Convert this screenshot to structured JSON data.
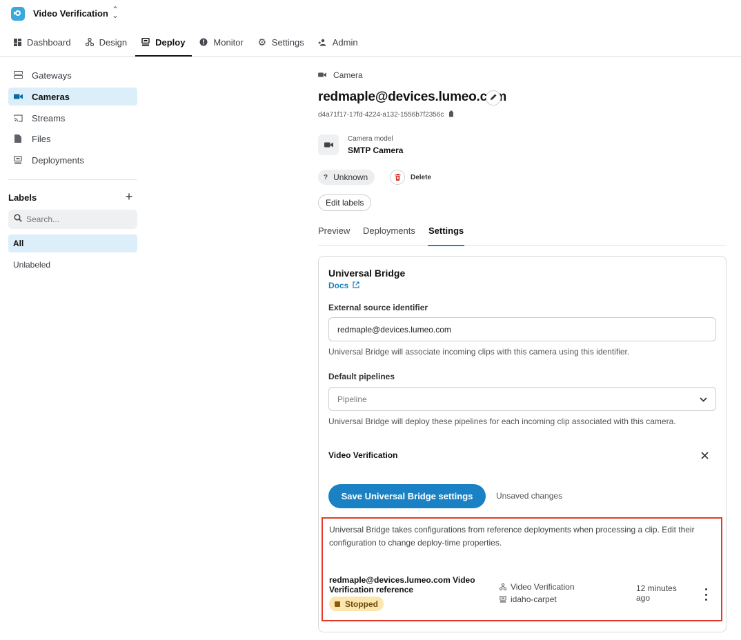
{
  "app": {
    "title": "Video Verification"
  },
  "nav": {
    "tabs": [
      {
        "label": "Dashboard",
        "icon": "dashboard-icon"
      },
      {
        "label": "Design",
        "icon": "design-icon"
      },
      {
        "label": "Deploy",
        "icon": "deploy-icon",
        "active": true
      },
      {
        "label": "Monitor",
        "icon": "monitor-icon"
      },
      {
        "label": "Settings",
        "icon": "gear-icon"
      },
      {
        "label": "Admin",
        "icon": "admin-icon"
      }
    ]
  },
  "sidebar": {
    "items": [
      {
        "label": "Gateways",
        "icon": "gateway-icon"
      },
      {
        "label": "Cameras",
        "icon": "camera-icon",
        "active": true
      },
      {
        "label": "Streams",
        "icon": "stream-icon"
      },
      {
        "label": "Files",
        "icon": "file-icon"
      },
      {
        "label": "Deployments",
        "icon": "deployment-icon"
      }
    ],
    "labels_title": "Labels",
    "search_placeholder": "Search...",
    "filters": [
      {
        "label": "All",
        "active": true
      },
      {
        "label": "Unlabeled"
      }
    ]
  },
  "camera": {
    "breadcrumb": "Camera",
    "name": "redmaple@devices.lumeo.com",
    "uuid": "d4a71f17-17fd-4224-a132-1556b7f2356c",
    "model_label": "Camera model",
    "model_value": "SMTP Camera",
    "status": "Unknown",
    "delete_label": "Delete",
    "edit_labels": "Edit labels"
  },
  "tabs": [
    {
      "label": "Preview"
    },
    {
      "label": "Deployments"
    },
    {
      "label": "Settings",
      "active": true
    }
  ],
  "bridge": {
    "title": "Universal Bridge",
    "docs": "Docs",
    "ext_source_label": "External source identifier",
    "ext_source_value": "redmaple@devices.lumeo.com",
    "ext_source_help": "Universal Bridge will associate incoming clips with this camera using this identifier.",
    "pipelines_label": "Default pipelines",
    "pipelines_placeholder": "Pipeline",
    "pipelines_help": "Universal Bridge will deploy these pipelines for each incoming clip associated with this camera.",
    "selected_pipeline": "Video Verification",
    "save_label": "Save Universal Bridge settings",
    "unsaved_label": "Unsaved changes",
    "reference": {
      "description": "Universal Bridge takes configurations from reference deployments when processing a clip. Edit their configuration to change deploy-time properties.",
      "name": "redmaple@devices.lumeo.com Video Verification reference",
      "status": "Stopped",
      "pipeline": "Video Verification",
      "gateway": "idaho-carpet",
      "time": "12 minutes ago"
    }
  },
  "colors": {
    "accent": "#1a82c4",
    "active_bg": "#dbeefa",
    "highlight_border": "#e23a2a",
    "stopped_bg": "#fbe7ad"
  }
}
